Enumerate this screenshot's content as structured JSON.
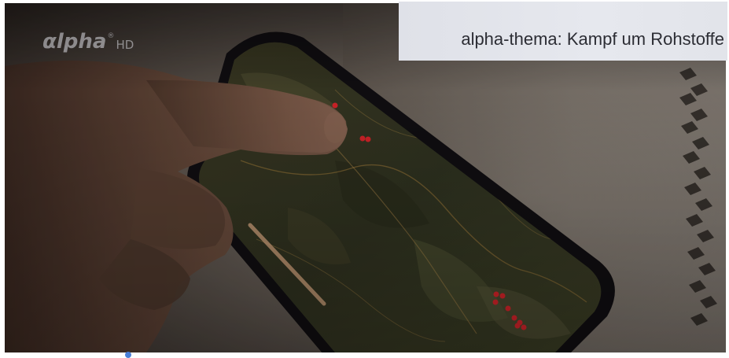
{
  "overlay": {
    "channel_logo": {
      "word": "αlpha",
      "registered_mark": "®",
      "suffix": "HD"
    },
    "title_banner": {
      "text": "alpha-thema: Kampf um Rohstoffe"
    }
  },
  "scene": {
    "description_icons": [
      "hand-image",
      "smartphone-image",
      "map-image",
      "tablecloth-image"
    ]
  },
  "colors": {
    "banner_background": "#e2e4ea",
    "banner_text": "#2c2d34",
    "logo": "#c8c8cd",
    "map_marker": "#e0242a"
  }
}
